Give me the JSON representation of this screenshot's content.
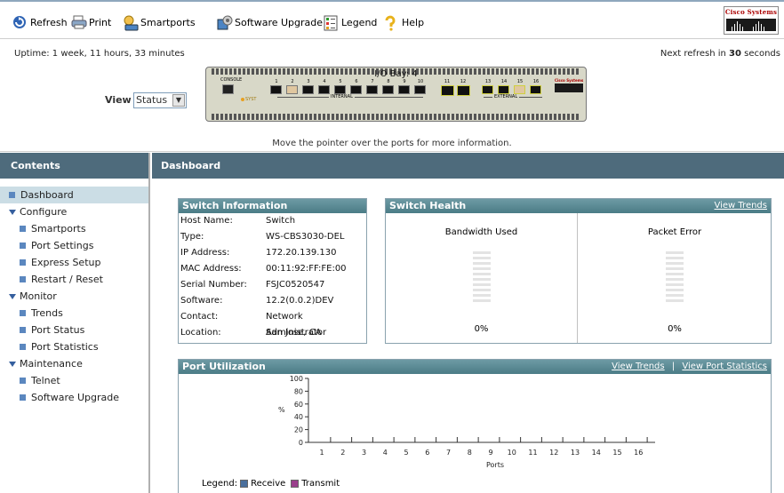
{
  "toolbar": {
    "refresh": "Refresh",
    "print": "Print",
    "smartports": "Smartports",
    "software_upgrade": "Software Upgrade",
    "legend": "Legend",
    "help": "Help",
    "logo_text": "Cisco Systems"
  },
  "status": {
    "uptime": "Uptime: 1 week, 11 hours, 33 minutes",
    "next_refresh_prefix": "Next refresh in ",
    "next_refresh_seconds": "30",
    "next_refresh_suffix": " seconds",
    "view_label": "View :",
    "view_value": "Status",
    "bay_title": "I/O Bay: 4",
    "console_label": "CONSOLE",
    "syst_label": "SYST",
    "internal_label": "INTERNAL",
    "external_label": "EXTERNAL",
    "device_brand": "Cisco Systems",
    "port_numbers": [
      "1",
      "2",
      "3",
      "4",
      "5",
      "6",
      "7",
      "8",
      "9",
      "10",
      "11",
      "12",
      "13",
      "14",
      "15",
      "16"
    ],
    "hint": "Move the pointer over the ports for more information."
  },
  "sidebar": {
    "title": "Contents",
    "items": [
      {
        "label": "Dashboard",
        "level": 0,
        "kind": "leaf",
        "active": true
      },
      {
        "label": "Configure",
        "level": 0,
        "kind": "group"
      },
      {
        "label": "Smartports",
        "level": 1,
        "kind": "leaf"
      },
      {
        "label": "Port Settings",
        "level": 1,
        "kind": "leaf"
      },
      {
        "label": "Express Setup",
        "level": 1,
        "kind": "leaf"
      },
      {
        "label": "Restart / Reset",
        "level": 1,
        "kind": "leaf"
      },
      {
        "label": "Monitor",
        "level": 0,
        "kind": "group"
      },
      {
        "label": "Trends",
        "level": 1,
        "kind": "leaf"
      },
      {
        "label": "Port Status",
        "level": 1,
        "kind": "leaf"
      },
      {
        "label": "Port Statistics",
        "level": 1,
        "kind": "leaf"
      },
      {
        "label": "Maintenance",
        "level": 0,
        "kind": "group"
      },
      {
        "label": "Telnet",
        "level": 1,
        "kind": "leaf"
      },
      {
        "label": "Software Upgrade",
        "level": 1,
        "kind": "leaf"
      }
    ]
  },
  "main": {
    "title": "Dashboard",
    "switch_info": {
      "title": "Switch Information",
      "rows": [
        {
          "k": "Host Name:",
          "v": "Switch"
        },
        {
          "k": "Type:",
          "v": "WS-CBS3030-DEL"
        },
        {
          "k": "IP Address:",
          "v": "172.20.139.130"
        },
        {
          "k": "MAC Address:",
          "v": "00:11:92:FF:FE:00"
        },
        {
          "k": "Serial Number:",
          "v": "FSJC0520547"
        },
        {
          "k": "Software:",
          "v": "12.2(0.0.2)DEV"
        },
        {
          "k": "Contact:",
          "v": "Network Administrator"
        },
        {
          "k": "Location:",
          "v": "San Jose, CA"
        }
      ]
    },
    "switch_health": {
      "title": "Switch Health",
      "view_trends": "View Trends",
      "bandwidth_title": "Bandwidth Used",
      "bandwidth_value": "0%",
      "bandwidth_fraction": 0,
      "packet_title": "Packet Error",
      "packet_value": "0%",
      "packet_fraction": 0
    },
    "port_util": {
      "title": "Port Utilization",
      "view_trends": "View Trends",
      "separator": "|",
      "view_port_stats": "View Port Statistics",
      "legend_label": "Legend:",
      "receive_label": "Receive",
      "transmit_label": "Transmit",
      "receive_color": "#4a6f9c",
      "transmit_color": "#9a3f8c"
    }
  },
  "chart_data": {
    "type": "bar",
    "categories": [
      "1",
      "2",
      "3",
      "4",
      "5",
      "6",
      "7",
      "8",
      "9",
      "10",
      "11",
      "12",
      "13",
      "14",
      "15",
      "16"
    ],
    "series": [
      {
        "name": "Receive",
        "values": [
          0,
          0,
          0,
          0,
          0,
          0,
          0,
          0,
          0,
          0,
          0,
          0,
          0,
          0,
          0,
          0
        ]
      },
      {
        "name": "Transmit",
        "values": [
          0,
          0,
          0,
          0,
          0,
          0,
          0,
          0,
          0,
          0,
          0,
          0,
          0,
          0,
          0,
          0
        ]
      }
    ],
    "yticks": [
      "100",
      "80",
      "60",
      "40",
      "20",
      "0"
    ],
    "ylabel": "%",
    "xlabel": "Ports",
    "ylim": [
      0,
      100
    ],
    "grid": false
  }
}
